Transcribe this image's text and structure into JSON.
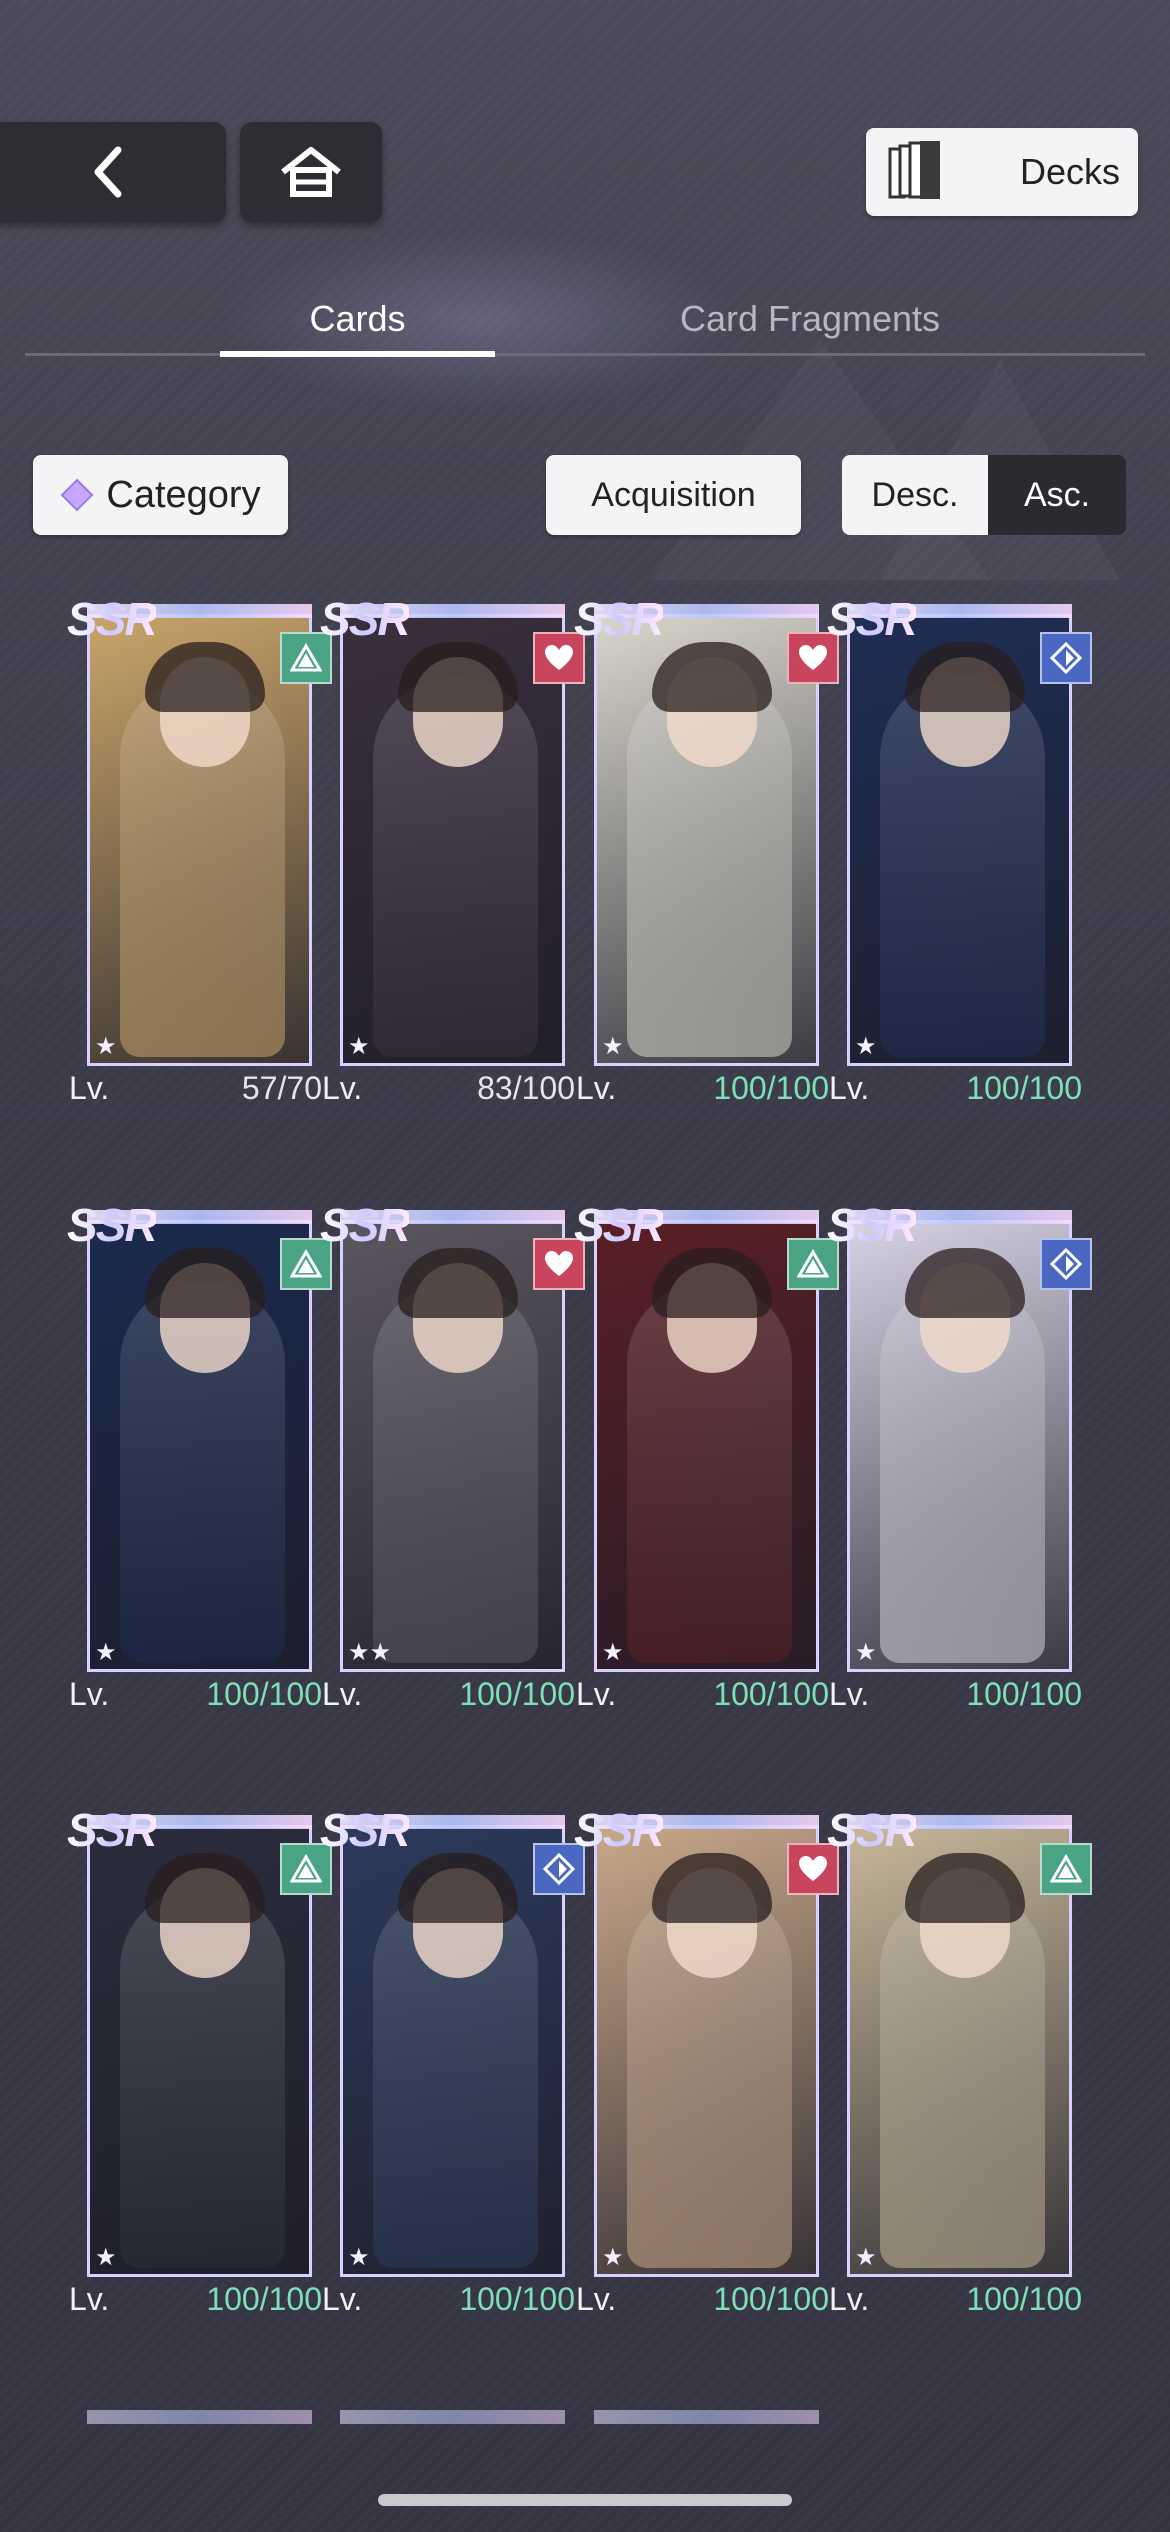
{
  "header": {
    "decks_label": "Decks"
  },
  "tabs": [
    {
      "label": "Cards",
      "active": true
    },
    {
      "label": "Card Fragments",
      "active": false
    }
  ],
  "filters": {
    "category_label": "Category",
    "acquisition_label": "Acquisition",
    "desc_label": "Desc.",
    "asc_label": "Asc.",
    "selected_order": "Asc."
  },
  "cards": [
    {
      "rarity": "SSR",
      "attribute_icon": "triangle-icon",
      "attribute_color": "#4aa383",
      "stars": "★",
      "lv_label": "Lv.",
      "level": "57/70",
      "maxed": false,
      "palette": "#c9a56a"
    },
    {
      "rarity": "SSR",
      "attribute_icon": "heart-icon",
      "attribute_color": "#c9455e",
      "stars": "★",
      "lv_label": "Lv.",
      "level": "83/100",
      "maxed": false,
      "palette": "#3a2f3d"
    },
    {
      "rarity": "SSR",
      "attribute_icon": "heart-icon",
      "attribute_color": "#c9455e",
      "stars": "★",
      "lv_label": "Lv.",
      "level": "100/100",
      "maxed": true,
      "palette": "#d9d6cc"
    },
    {
      "rarity": "SSR",
      "attribute_icon": "diamond-icon",
      "attribute_color": "#4a67c2",
      "stars": "★",
      "lv_label": "Lv.",
      "level": "100/100",
      "maxed": true,
      "palette": "#1f2e55"
    },
    {
      "rarity": "SSR",
      "attribute_icon": "triangle-icon",
      "attribute_color": "#4aa383",
      "stars": "★",
      "lv_label": "Lv.",
      "level": "100/100",
      "maxed": true,
      "palette": "#1b2a4e"
    },
    {
      "rarity": "SSR",
      "attribute_icon": "heart-icon",
      "attribute_color": "#c9455e",
      "stars": "★★",
      "lv_label": "Lv.",
      "level": "100/100",
      "maxed": true,
      "palette": "#5b5660"
    },
    {
      "rarity": "SSR",
      "attribute_icon": "triangle-icon",
      "attribute_color": "#4aa383",
      "stars": "★",
      "lv_label": "Lv.",
      "level": "100/100",
      "maxed": true,
      "palette": "#5a1f25"
    },
    {
      "rarity": "SSR",
      "attribute_icon": "diamond-icon",
      "attribute_color": "#4a67c2",
      "stars": "★",
      "lv_label": "Lv.",
      "level": "100/100",
      "maxed": true,
      "palette": "#d7d2e4"
    },
    {
      "rarity": "SSR",
      "attribute_icon": "triangle-icon",
      "attribute_color": "#4aa383",
      "stars": "★",
      "lv_label": "Lv.",
      "level": "100/100",
      "maxed": true,
      "palette": "#2b2d3d"
    },
    {
      "rarity": "SSR",
      "attribute_icon": "diamond-icon",
      "attribute_color": "#4a67c2",
      "stars": "★",
      "lv_label": "Lv.",
      "level": "100/100",
      "maxed": true,
      "palette": "#2c3a5c"
    },
    {
      "rarity": "SSR",
      "attribute_icon": "heart-icon",
      "attribute_color": "#c9455e",
      "stars": "★",
      "lv_label": "Lv.",
      "level": "100/100",
      "maxed": true,
      "palette": "#c8a88a"
    },
    {
      "rarity": "SSR",
      "attribute_icon": "triangle-icon",
      "attribute_color": "#4aa383",
      "stars": "★",
      "lv_label": "Lv.",
      "level": "100/100",
      "maxed": true,
      "palette": "#c7b79a"
    }
  ]
}
